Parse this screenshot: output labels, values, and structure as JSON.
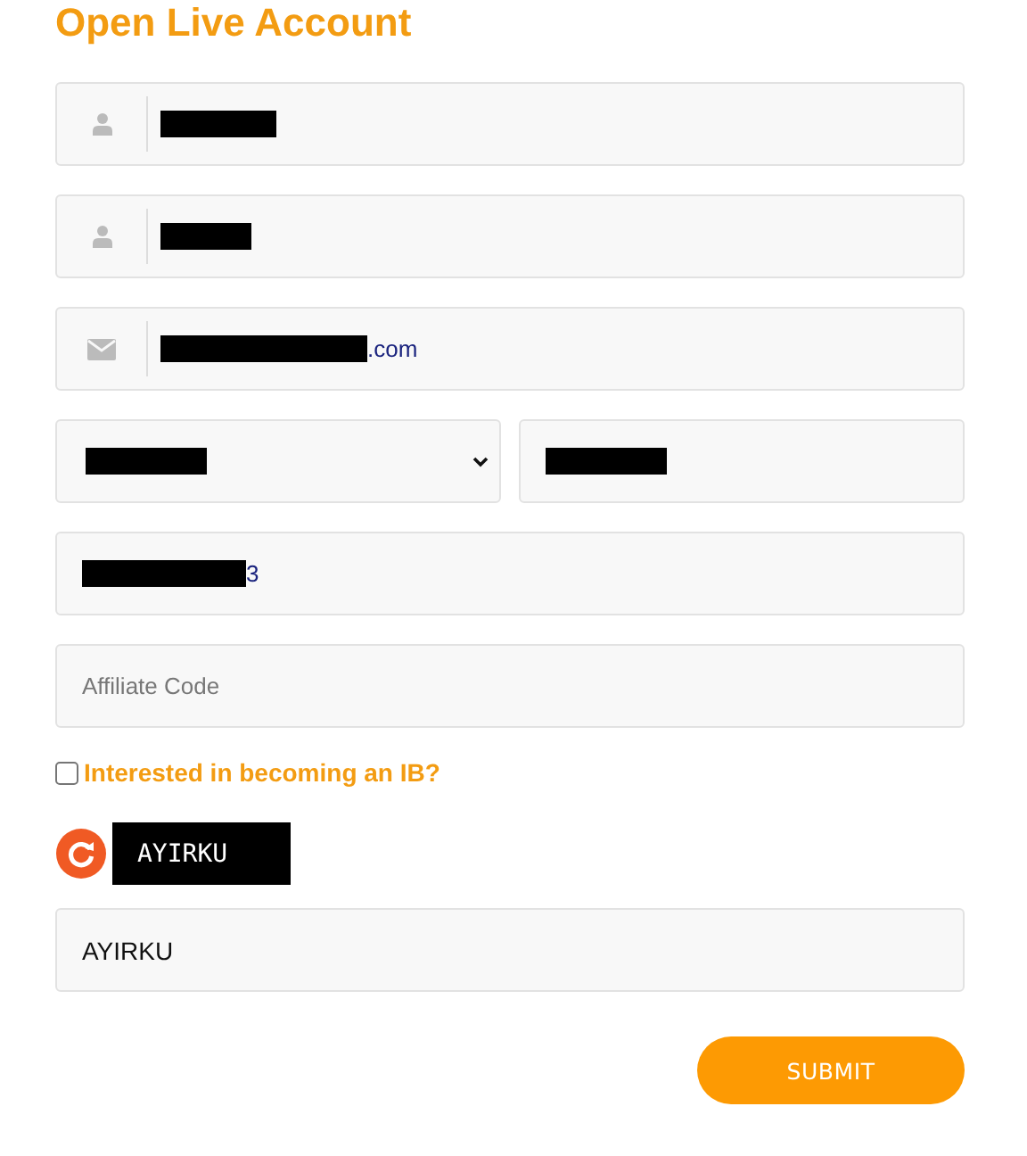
{
  "title": "Open Live Account",
  "fields": [
    {
      "kind": "person-input",
      "redacted": true
    },
    {
      "kind": "person-input",
      "redacted": true
    },
    {
      "kind": "email-input",
      "redacted": true,
      "value": ".com"
    },
    {
      "kind": "pair",
      "items": [
        {
          "kind": "select",
          "redacted": true
        },
        {
          "kind": "input",
          "redacted": true
        }
      ]
    },
    {
      "kind": "input",
      "redacted": true,
      "value": "3"
    },
    {
      "kind": "input",
      "placeholder": "Affiliate Code"
    }
  ],
  "ib_checkbox": {
    "label": "Interested in becoming an IB?",
    "checked": false
  },
  "captcha": {
    "code": "AYIRKU"
  },
  "captcha_input": {
    "value": "AYIRKU"
  },
  "submit": {
    "label": "SUBMIT"
  }
}
